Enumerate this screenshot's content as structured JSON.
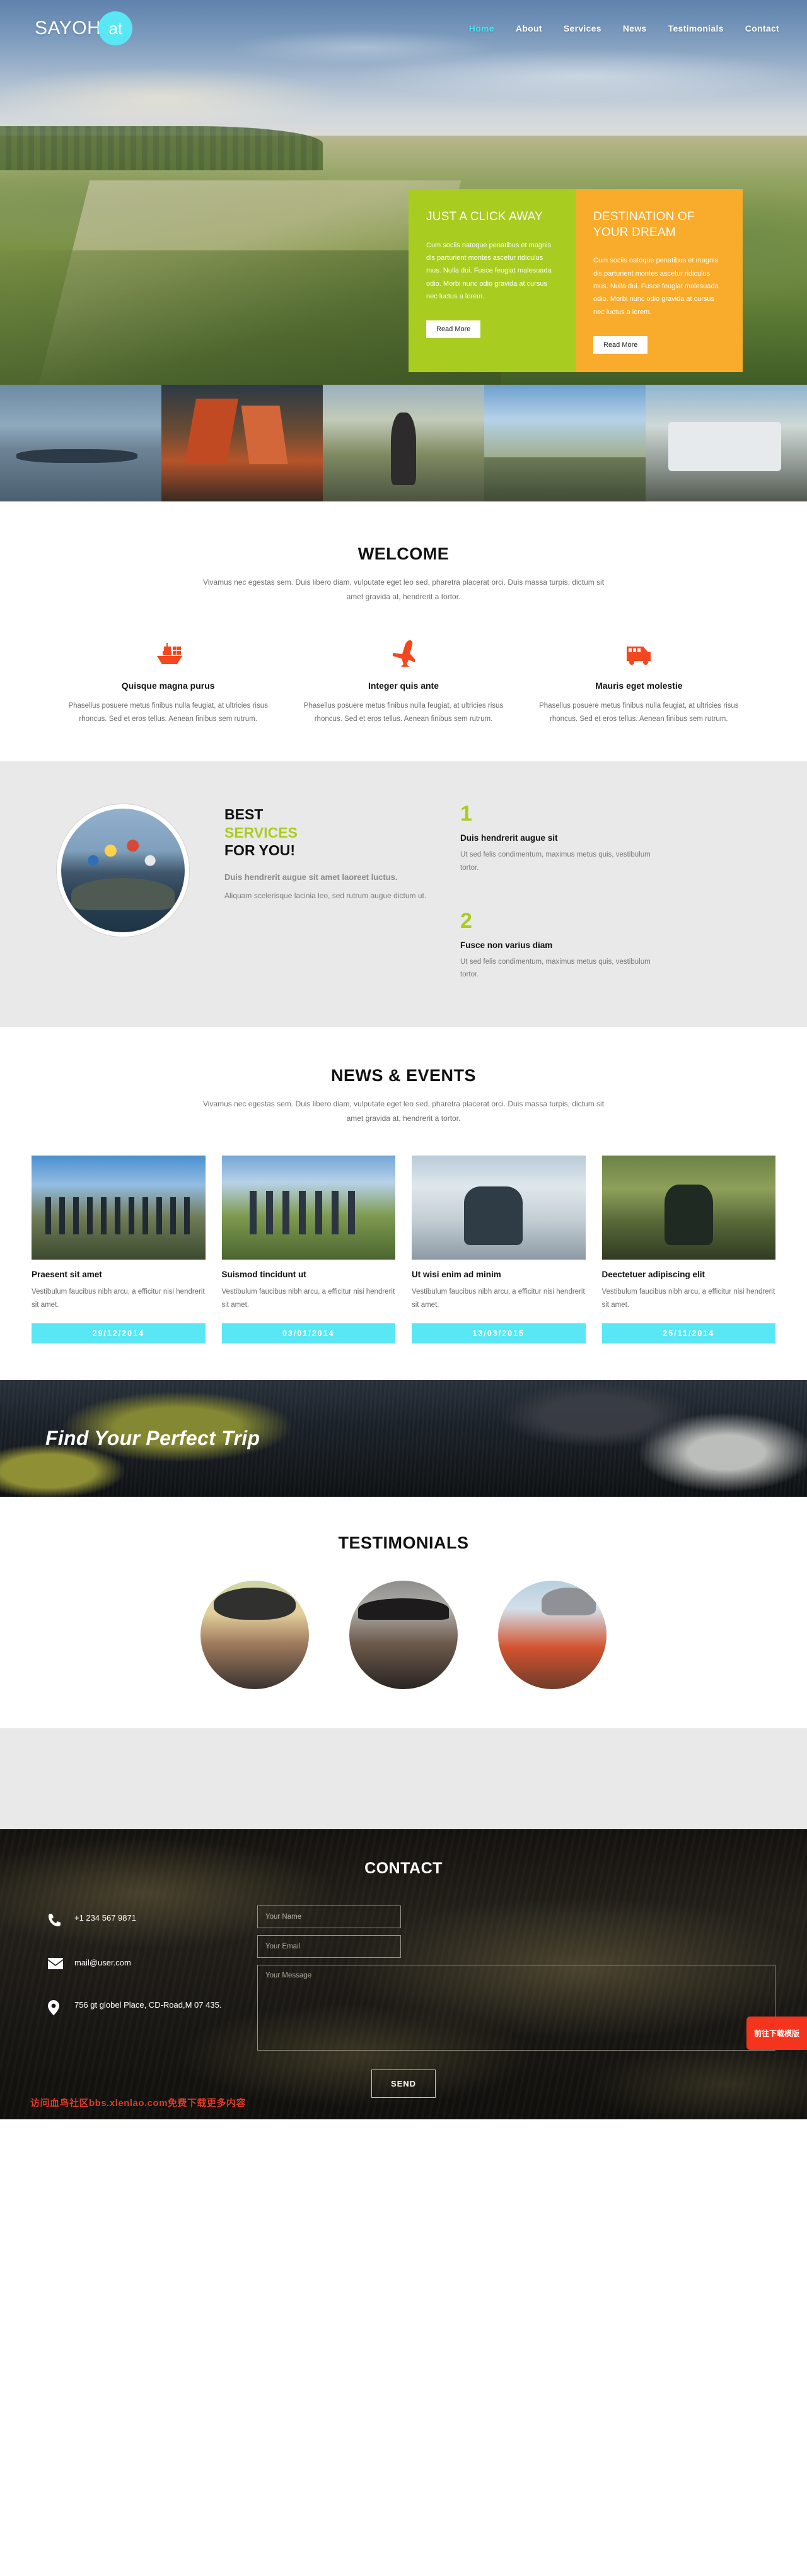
{
  "header": {
    "logo_main": "SAYOH",
    "logo_badge": "at",
    "nav": [
      {
        "label": "Home",
        "active": true
      },
      {
        "label": "About",
        "active": false
      },
      {
        "label": "Services",
        "active": false
      },
      {
        "label": "News",
        "active": false
      },
      {
        "label": "Testimonials",
        "active": false
      },
      {
        "label": "Contact",
        "active": false
      }
    ]
  },
  "hero": {
    "promos": [
      {
        "title": "JUST A CLICK AWAY",
        "body": "Cum sociis natoque penatibus et magnis dis parturient montes ascetur ridiculus mus. Nulla dui. Fusce feugiat malesuada odio. Morbi nunc odio gravida at cursus nec luctus a lorem.",
        "button": "Read More",
        "color": "#a9cc20"
      },
      {
        "title": "DESTINATION OF YOUR DREAM",
        "body": "Cum sociis natoque penatibus et magnis dis parturient montes ascetur ridiculus mus. Nulla dui. Fusce feugiat malesuada odio. Morbi nunc odio gravida at cursus nec luctus a lorem.",
        "button": "Read More",
        "color": "#f9ac2c"
      }
    ],
    "thumbnails": [
      "rowing-boat-thumb",
      "junk-boat-thumb",
      "woman-walking-thumb",
      "mountain-road-thumb",
      "tour-bus-thumb"
    ]
  },
  "welcome": {
    "title": "WELCOME",
    "subtitle": "Vivamus nec egestas sem. Duis libero diam, vulputate eget leo sed, pharetra placerat orci. Duis massa turpis, dictum sit amet gravida at, hendrerit a tortor.",
    "features": [
      {
        "icon": "ship-icon",
        "title": "Quisque magna purus",
        "body": "Phasellus posuere metus finibus nulla feugiat, at ultricies risus rhoncus. Sed et eros tellus. Aenean finibus sem rutrum."
      },
      {
        "icon": "airplane-icon",
        "title": "Integer quis ante",
        "body": "Phasellus posuere metus finibus nulla feugiat, at ultricies risus rhoncus. Sed et eros tellus. Aenean finibus sem rutrum."
      },
      {
        "icon": "bus-icon",
        "title": "Mauris eget molestie",
        "body": "Phasellus posuere metus finibus nulla feugiat, at ultricies risus rhoncus. Sed et eros tellus. Aenean finibus sem rutrum."
      }
    ]
  },
  "services": {
    "heading_line1": "BEST",
    "heading_line2": "SERVICES",
    "heading_line3": "FOR YOU!",
    "lead": "Duis hendrerit augue sit amet laoreet luctus.",
    "body": "Aliquam scelerisque lacinia leo, sed rutrum augue dictum ut.",
    "accent_color": "#a9cc20",
    "items": [
      {
        "number": "1",
        "title": "Duis hendrerit augue sit",
        "body": "Ut sed felis condimentum, maximus metus quis, vestibulum tortor."
      },
      {
        "number": "2",
        "title": "Fusce non varius diam",
        "body": "Ut sed felis condimentum, maximus metus quis, vestibulum tortor."
      }
    ]
  },
  "news": {
    "title": "NEWS & EVENTS",
    "subtitle": "Vivamus nec egestas sem. Duis libero diam, vulputate eget leo sed, pharetra placerat orci. Duis massa turpis, dictum sit amet gravida at, hendrerit a tortor.",
    "date_badge_color": "#5ae7f5",
    "cards": [
      {
        "image": "hikers-on-rock-thumb",
        "title": "Praesent sit amet",
        "body": "Vestibulum faucibus nibh arcu, a efficitur nisi hendrerit sit amet.",
        "date": "29/12/2014"
      },
      {
        "image": "group-pointing-thumb",
        "title": "Suismod tincidunt ut",
        "body": "Vestibulum faucibus nibh arcu, a efficitur nisi hendrerit sit amet.",
        "date": "03/01/2014"
      },
      {
        "image": "snow-hiker-thumb",
        "title": "Ut wisi enim ad minim",
        "body": "Vestibulum faucibus nibh arcu, a efficitur nisi hendrerit sit amet.",
        "date": "13/03/2015"
      },
      {
        "image": "mountain-biker-thumb",
        "title": "Deectetuer adipiscing elit",
        "body": "Vestibulum faucibus nibh arcu, a efficitur nisi hendrerit sit amet.",
        "date": "25/11/2014"
      }
    ]
  },
  "trip_banner": {
    "title": "Find Your Perfect Trip"
  },
  "testimonials": {
    "title": "TESTIMONIALS",
    "avatars": [
      "woman-with-hat-avatar",
      "woman-with-headphones-avatar",
      "woman-in-orange-avatar"
    ]
  },
  "contact": {
    "title": "CONTACT",
    "info": [
      {
        "icon": "phone-icon",
        "value": "+1 234 567 9871"
      },
      {
        "icon": "mail-icon",
        "value": "mail@user.com"
      },
      {
        "icon": "location-pin-icon",
        "value": "756 gt globel Place, CD-Road,M 07 435."
      }
    ],
    "form": {
      "name_placeholder": "Your Name",
      "name_value": "",
      "email_placeholder": "Your Email",
      "email_value": "",
      "message_placeholder": "Your Message",
      "message_value": "",
      "send_label": "SEND"
    },
    "watermark": "访问血鸟社区bbs.xlenlao.com免费下载更多内容",
    "download_badge": "前往下载模版"
  }
}
